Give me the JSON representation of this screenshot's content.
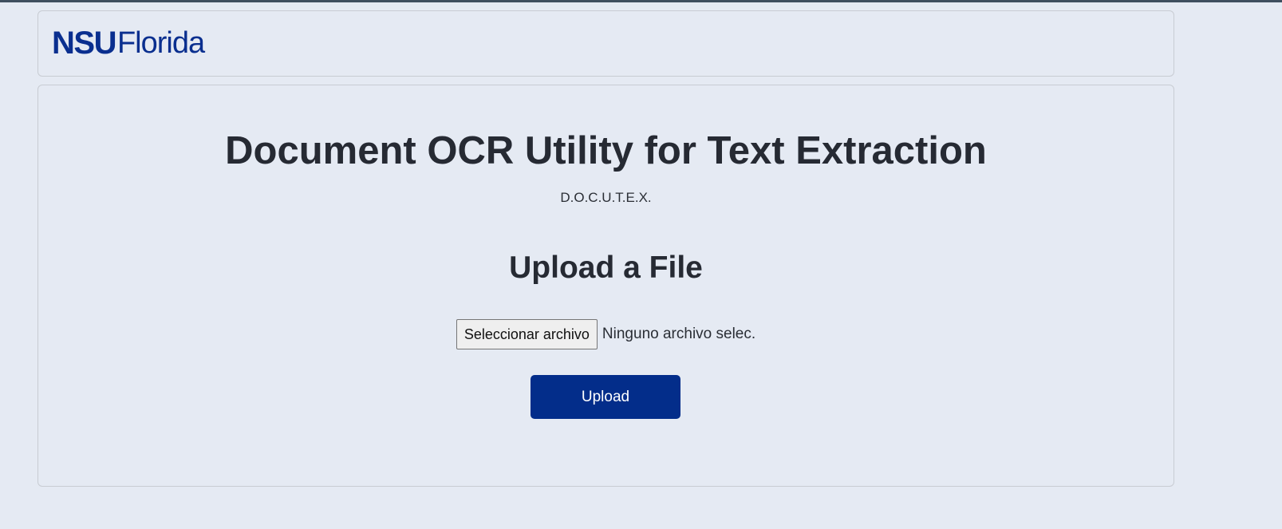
{
  "colors": {
    "page_background": "#e5eaf3",
    "brand_blue": "#0a2f8f",
    "upload_button_background": "#032d8a",
    "text_dark": "#262a33"
  },
  "header": {
    "logo": {
      "strong_text": "NSU",
      "light_text": "Florida"
    }
  },
  "main": {
    "title": "Document OCR Utility for Text Extraction",
    "subtitle": "D.O.C.U.T.E.X.",
    "upload_heading": "Upload a File",
    "file_input": {
      "button_label": "Seleccionar archivo",
      "status_text": "Ninguno archivo selec."
    },
    "upload_button_label": "Upload"
  }
}
